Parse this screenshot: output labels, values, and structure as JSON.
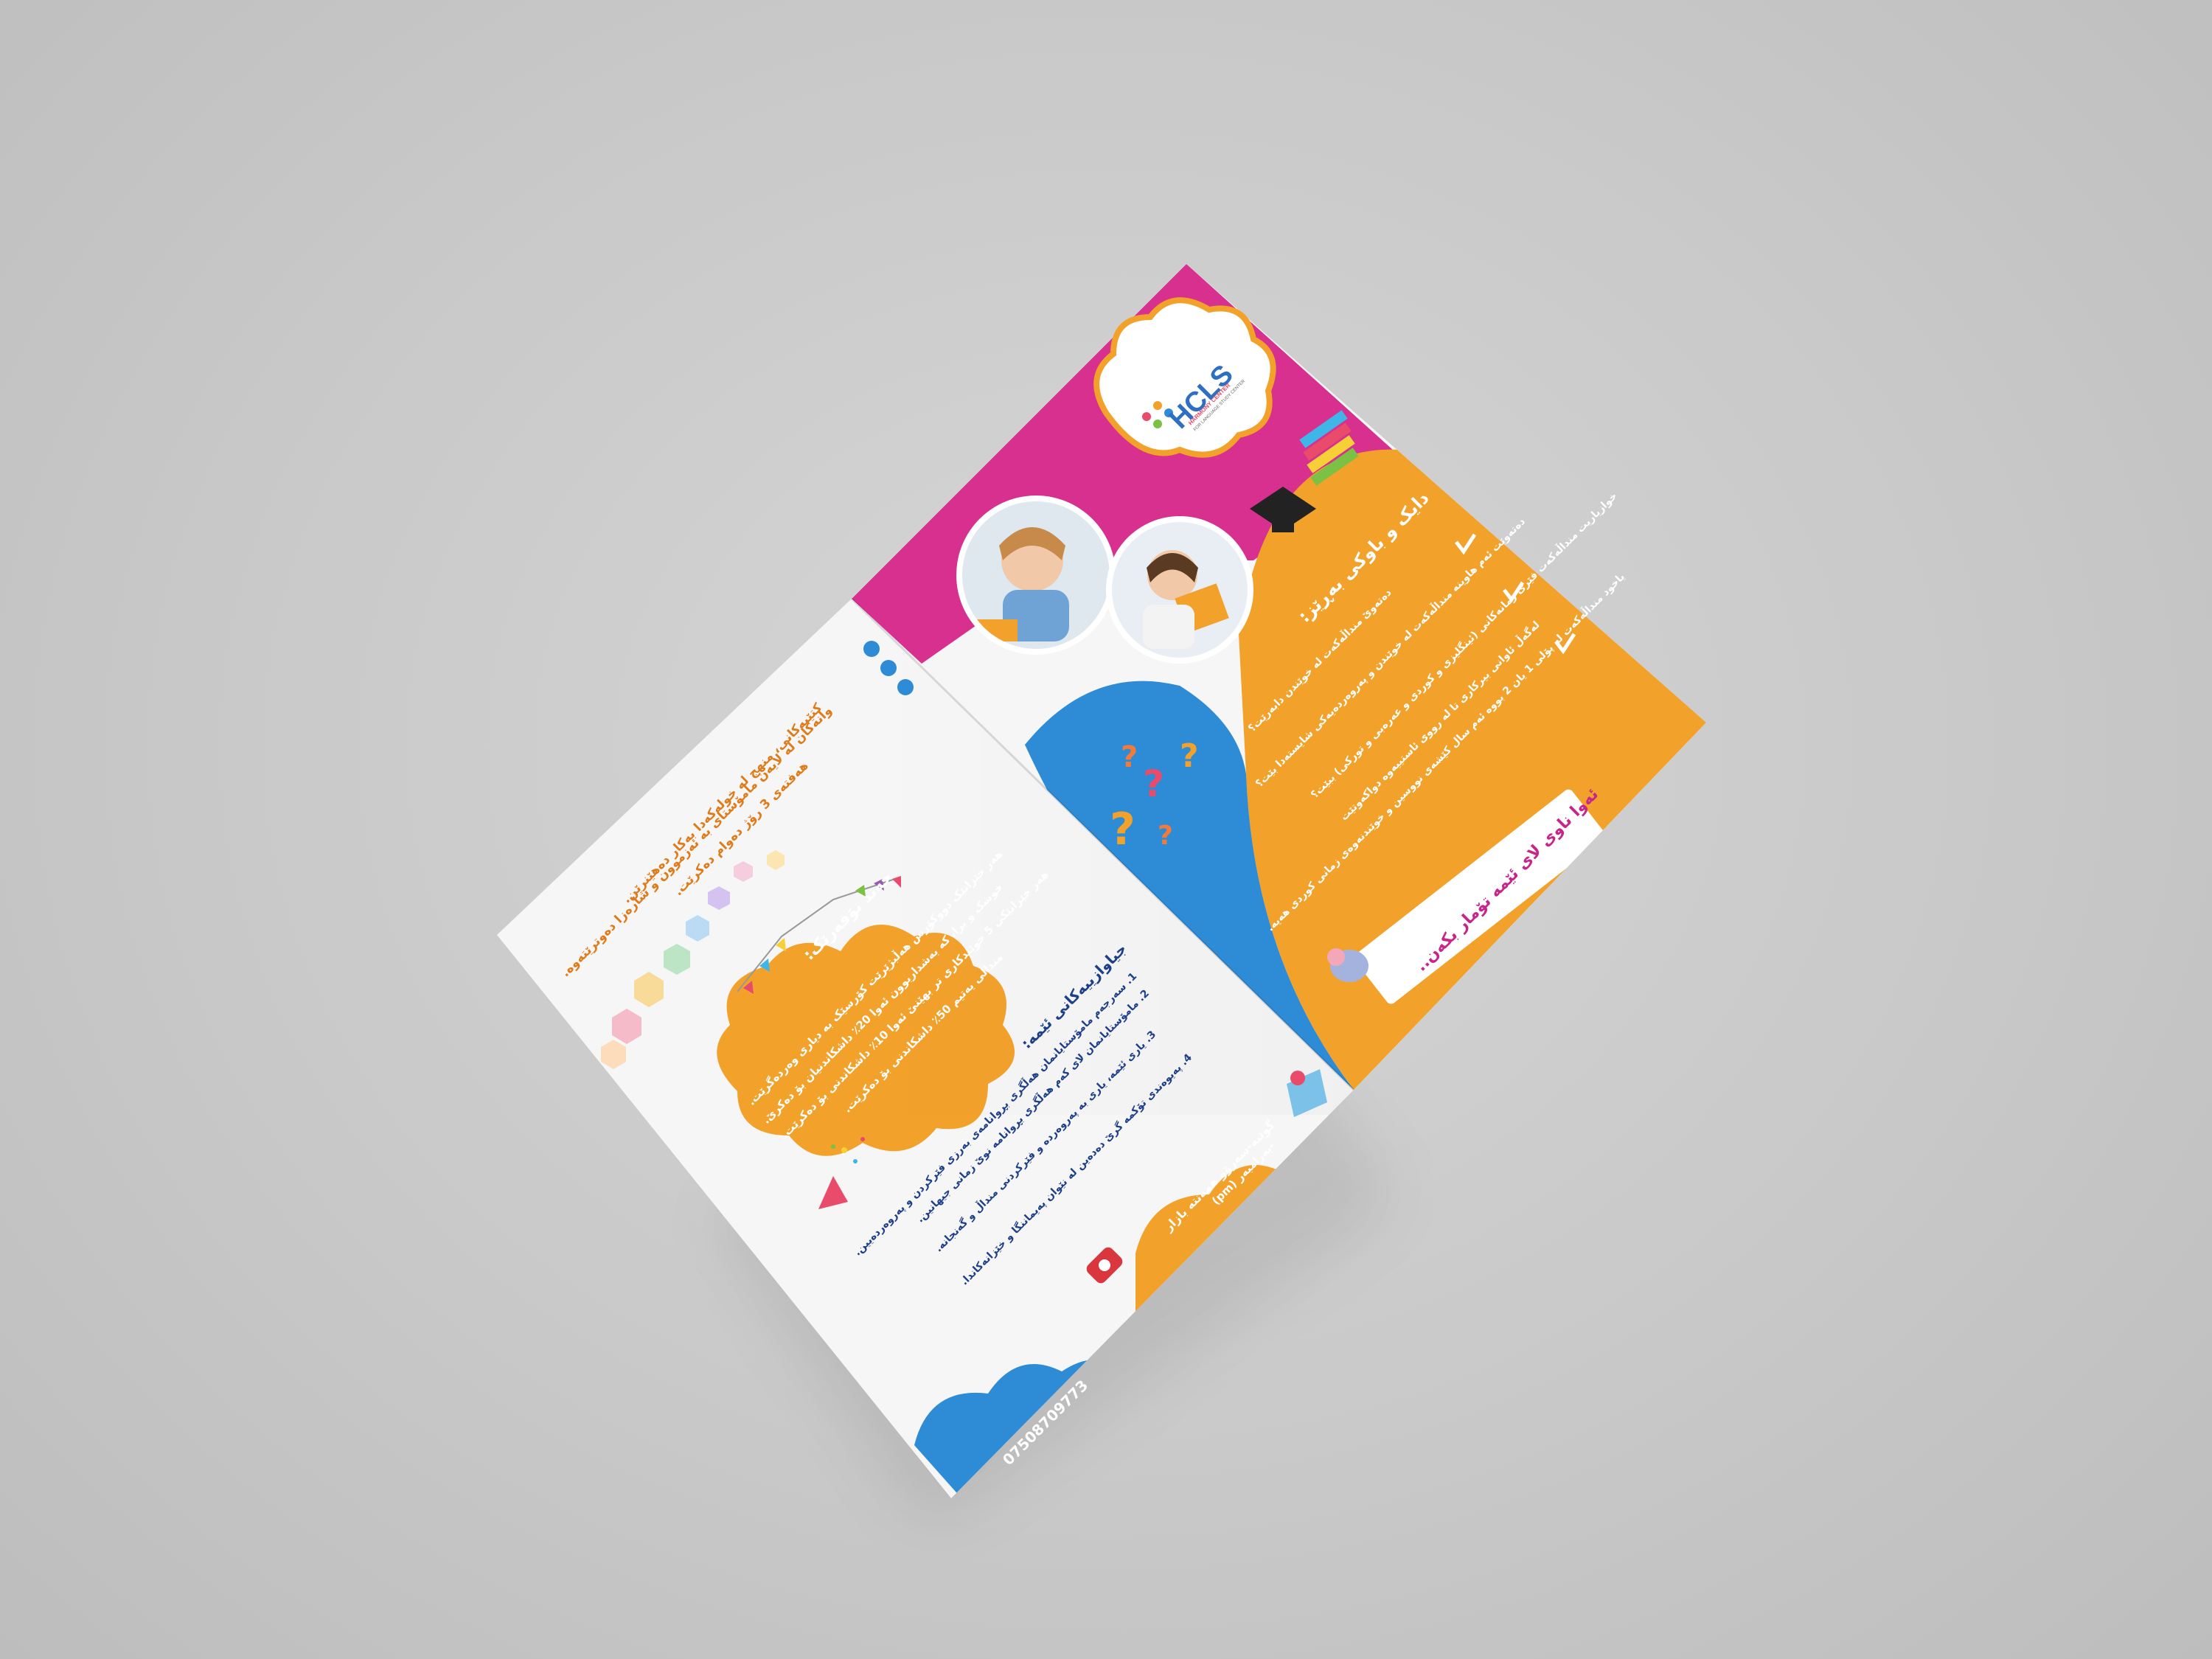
{
  "brand": {
    "logo_text": "HCLS",
    "logo_subtitle": "HARMONY CENTER",
    "logo_tagline": "FOR LANGUAGE STUDY CENTER"
  },
  "right_panel": {
    "heading": "دایک و باوکی بەڕێز:",
    "bullets": [
      "دەتەوێ منداڵەکەت لە خوێندن دابەرێت؟",
      "دەتەوێت ئەم هاوینە منداڵەکەت لە خوێندن و پەروەردەیەکی شایستەدا بێت؟",
      "خوازیاریت منداڵەکەت فێری زمانەکانی (ئینگلیزی و کوردی و عەرەبی و تورکی) ببێت؟",
      "یاخود منداڵەکەت لە پۆلی 1 یان 2 بووە ئەم سال کێشەی نووسین و خوێندنەوەی زمانی کوردی هەیە."
    ],
    "closing": "لەگەڵ ئاوانی بیرکاری تا لە رووی ئاستییەوە دواکەوتێت",
    "cta": "ئەوا ناوی لای ئێمە تۆمار بکەن.."
  },
  "left_panel": {
    "features": [
      "وانەکان لە لایەن مامۆستای بە ئەزموون و شارەزا دەوترێتەوە.",
      "کتێبەکانی، منهج لە خولەکەدا بەکار دەهێنرێن.",
      "هەفتەی 3 رۆژ دەوام دەکرێت."
    ],
    "offers_title": "چەند نۆفەرێک:",
    "offers": [
      "هەر خێزانێک دووکۆرس هەڵبژێرێت کۆرسێک بە دیاری وەردەگرێت.",
      "خوشک و برا، کە بەشداربوون ئەوا 20٪ داشکاندنیان بۆ دەکرێ.",
      "هەر خێزانێکی 5 خوێندکاری تر بهێنێ ئەوا 10٪ داشکاندنی بۆ دەکرێت.",
      "منداڵی یەتیم 50٪ داشکاندنی بۆ دەکرێت."
    ],
    "diff_title": "جیاوازییەکانی ئێمە:",
    "diffs": [
      "1. سەرجەم مامۆستایانمان هەڵگری بڕوانامەی بەرزی فێرکردن و پەروەردەیین.",
      "2. مامۆستایانمان لای کەم هەڵگری بڕوانامە نوێ زمانی جیهانین.",
      "3. یاری ئێمە، یاری بە پەروەردە و فێرکردنی منداڵ و گەنجانە.",
      "4. پەیوەندی تۆکمە گرێ دەدەین لە نێوان پەیماننگا و خێزانەکاندا."
    ],
    "address_line1": "گوێبە-سەرۆو همەنته بازار",
    "address_line2": "(pm) بەرامبەر-",
    "phone": "07508709773"
  },
  "colors": {
    "pink": "#d8308f",
    "orange": "#f2a12b",
    "blue": "#2e8bd6",
    "white": "#ffffff",
    "heading_pink": "#c8258a"
  },
  "icons": [
    "phone-icon",
    "map-pin-icon",
    "graduation-cap-icon",
    "books-icon",
    "question-marks-icon",
    "party-popper-icon",
    "bunting-icon",
    "flower-bullet-icon",
    "check-icon",
    "elephant-icon",
    "hexagon-decoration"
  ]
}
